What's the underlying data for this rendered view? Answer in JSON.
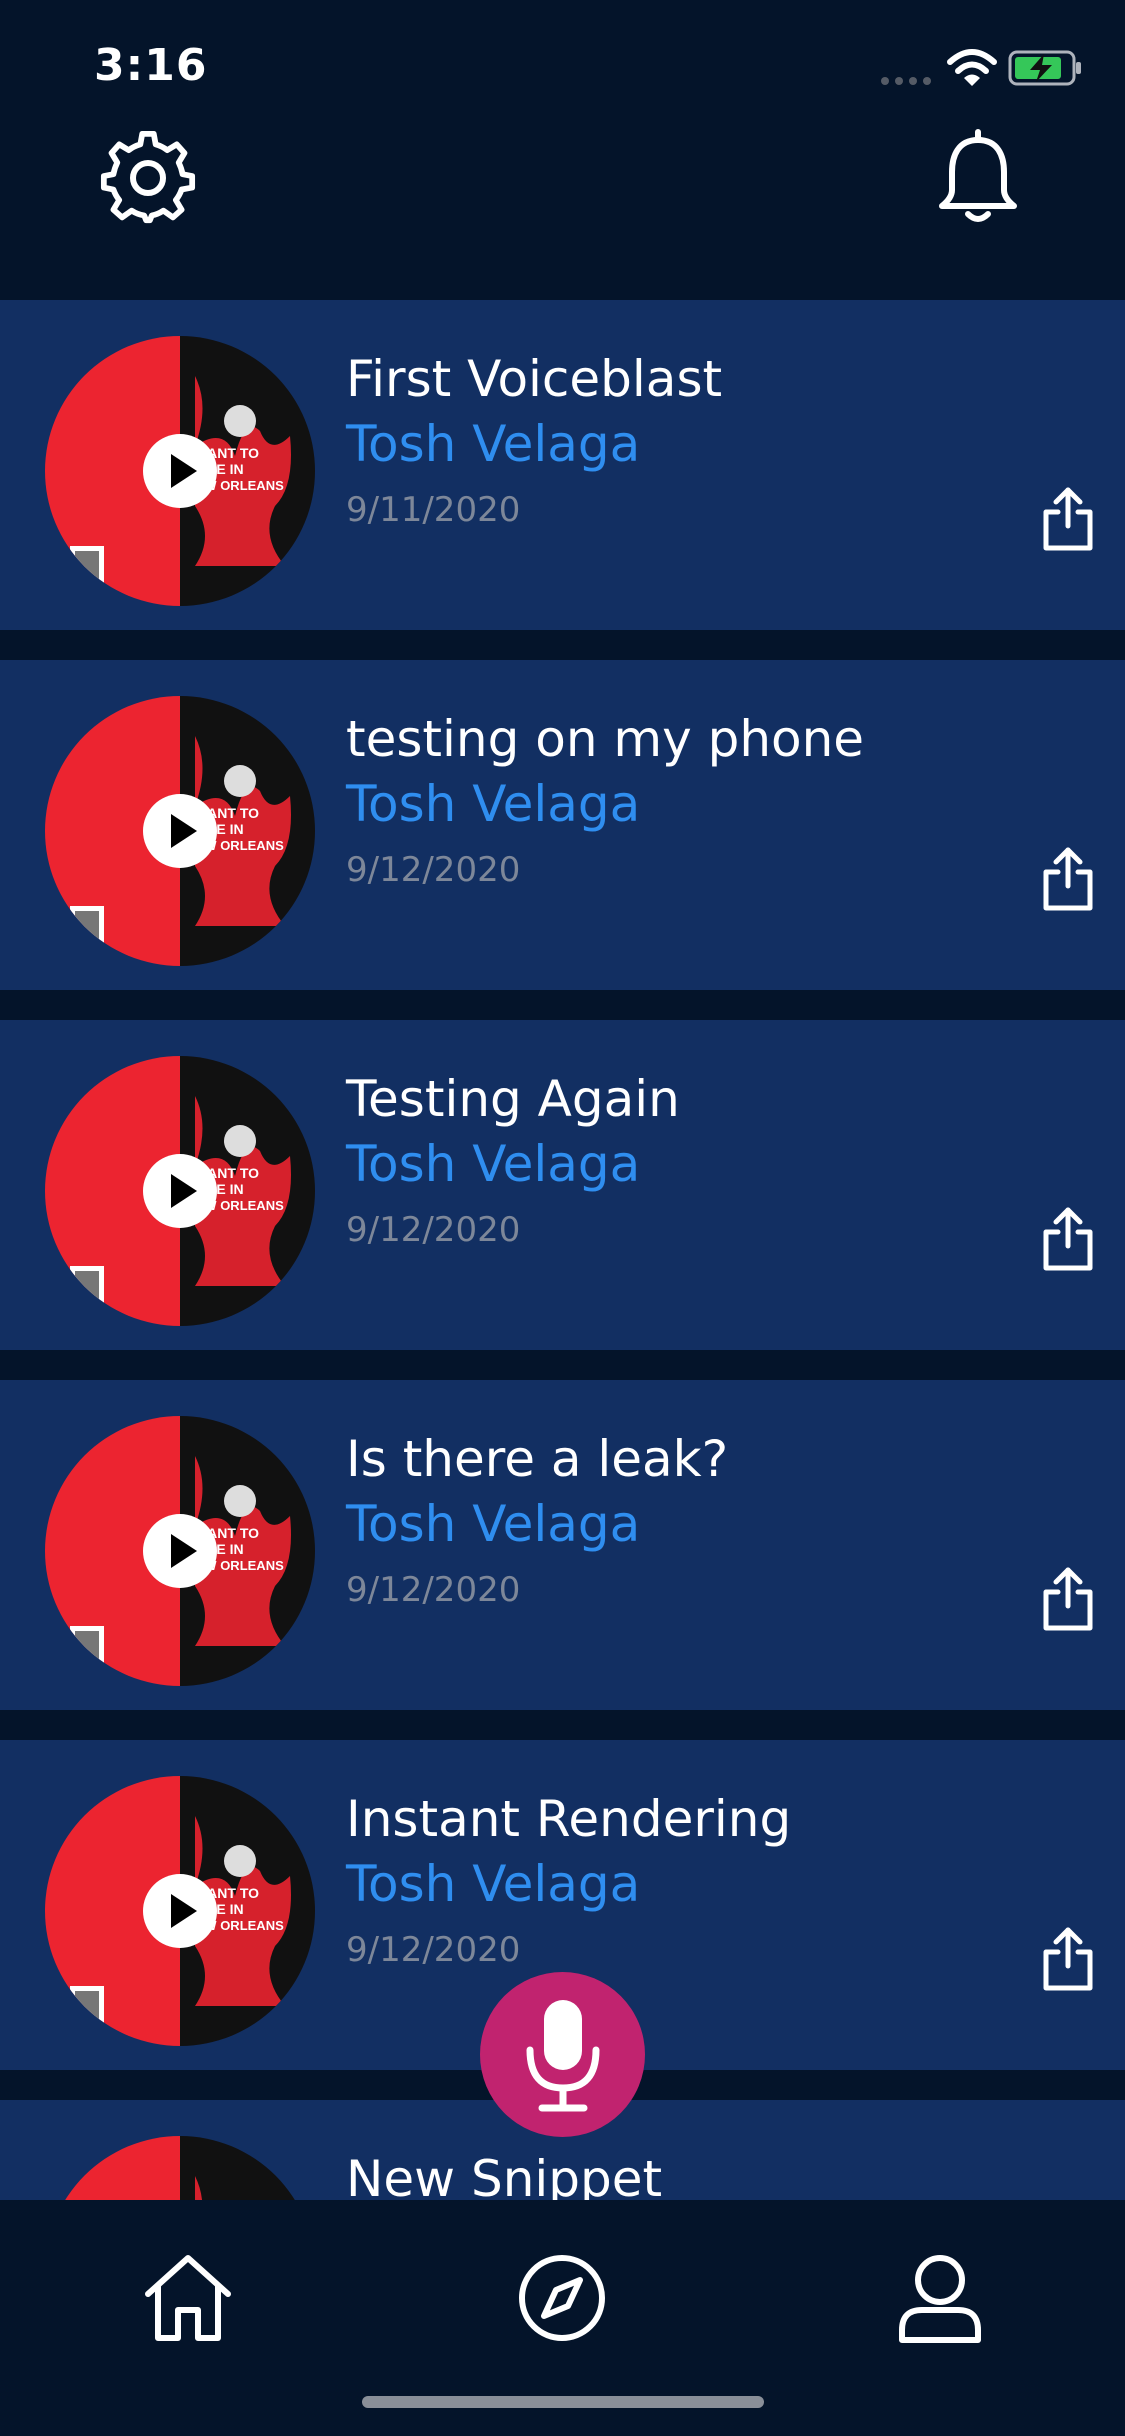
{
  "status_bar": {
    "time": "3:16"
  },
  "header": {
    "settings_icon": "gear-icon",
    "notifications_icon": "bell-icon"
  },
  "feed": {
    "items": [
      {
        "title": "First Voiceblast",
        "author": "Tosh Velaga",
        "date": "9/11/2020"
      },
      {
        "title": "testing on my phone",
        "author": "Tosh Velaga",
        "date": "9/12/2020"
      },
      {
        "title": "Testing Again",
        "author": "Tosh Velaga",
        "date": "9/12/2020"
      },
      {
        "title": "Is there a leak?",
        "author": "Tosh Velaga",
        "date": "9/12/2020"
      },
      {
        "title": "Instant Rendering",
        "author": "Tosh Velaga",
        "date": "9/12/2020"
      },
      {
        "title": "New Snippet"
      }
    ]
  },
  "cover_art": {
    "caption_lines": [
      "I WANT TO",
      "DIE IN",
      "NEW ORLEANS"
    ]
  },
  "colors": {
    "background": "#04142a",
    "card": "#122f62",
    "author": "#2f8ef0",
    "date": "#7d8799",
    "record_button": "#c1236f",
    "art_red": "#ec2430",
    "art_black": "#111111"
  },
  "tab_bar": {
    "tabs": [
      "home-icon",
      "compass-icon",
      "profile-icon"
    ]
  }
}
